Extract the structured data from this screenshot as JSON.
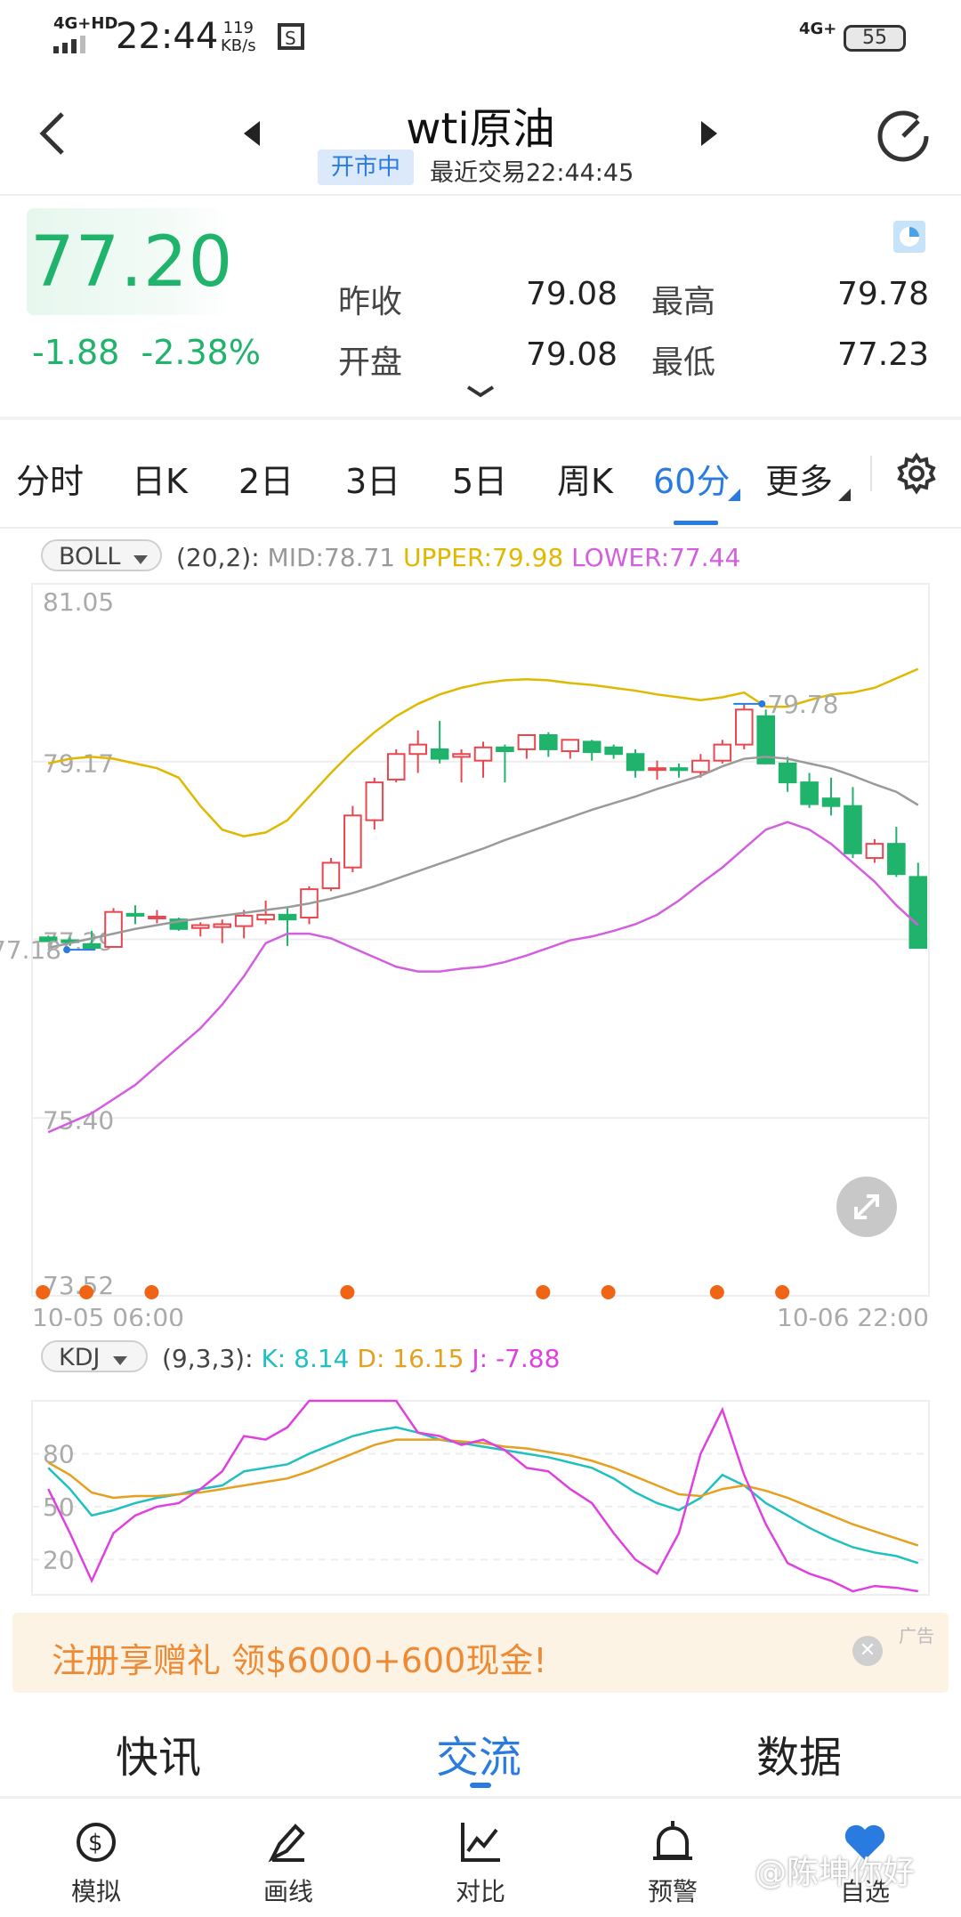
{
  "status_bar": {
    "network": "4G+HD",
    "time": "22:44",
    "speed_value": "119",
    "speed_unit": "KB/s",
    "network_right": "4G+",
    "battery": "55"
  },
  "header": {
    "title": "wti原油",
    "badge": "开市中",
    "last_trade": "最近交易22:44:45"
  },
  "quote": {
    "price": "77.20",
    "change": "-1.88",
    "change_pct": "-2.38%",
    "prev_close_label": "昨收",
    "prev_close": "79.08",
    "high_label": "最高",
    "high": "79.78",
    "open_label": "开盘",
    "open": "79.08",
    "low_label": "最低",
    "low": "77.23"
  },
  "tabs": {
    "t1": "分时",
    "t2": "日K",
    "t3": "2日",
    "t4": "3日",
    "t5": "5日",
    "t6": "周K",
    "t7": "60分",
    "t8": "更多"
  },
  "boll": {
    "name": "BOLL",
    "params": "(20,2):",
    "mid": "MID:78.71",
    "upper": "UPPER:79.98",
    "lower": "LOWER:77.44"
  },
  "kdj": {
    "name": "KDJ",
    "params": "(9,3,3):",
    "k": "K: 8.14",
    "d": "D: 16.15",
    "j": "J: -7.88"
  },
  "ad": {
    "text": "注册享赠礼 领$6000+600现金!",
    "tag": "广告"
  },
  "sections": {
    "s1": "快讯",
    "s2": "交流",
    "s3": "数据"
  },
  "bottom_nav": {
    "b1": "模拟",
    "b2": "画线",
    "b3": "对比",
    "b4": "预警",
    "b5": "自选"
  },
  "watermark": "@陈坤你好",
  "colors": {
    "up": "#e8474f",
    "down": "#1fb36b",
    "accent": "#2a7be0",
    "boll_upper": "#e0b800",
    "boll_mid": "#9a9a9a",
    "boll_lower": "#d45ee0",
    "kdj_k": "#20c0c0",
    "kdj_d": "#e6a020",
    "kdj_j": "#e040e0"
  },
  "chart_data": [
    {
      "type": "candlestick",
      "indicator": "BOLL(20,2)",
      "y_ticks": [
        "81.05",
        "79.17",
        "77.29",
        "75.40",
        "73.52"
      ],
      "ylim": [
        73.52,
        81.05
      ],
      "x_labels": [
        "10-05 06:00",
        "10-06 22:00"
      ],
      "annotations": {
        "max": "79.78",
        "min": "77.18"
      },
      "candles": [
        {
          "o": 77.31,
          "h": 77.33,
          "l": 77.27,
          "c": 77.27
        },
        {
          "o": 77.28,
          "h": 77.31,
          "l": 77.22,
          "c": 77.26
        },
        {
          "o": 77.24,
          "h": 77.38,
          "l": 77.18,
          "c": 77.2
        },
        {
          "o": 77.21,
          "h": 77.62,
          "l": 77.2,
          "c": 77.58
        },
        {
          "o": 77.56,
          "h": 77.65,
          "l": 77.45,
          "c": 77.54
        },
        {
          "o": 77.53,
          "h": 77.6,
          "l": 77.46,
          "c": 77.53
        },
        {
          "o": 77.5,
          "h": 77.52,
          "l": 77.38,
          "c": 77.4
        },
        {
          "o": 77.41,
          "h": 77.47,
          "l": 77.32,
          "c": 77.44
        },
        {
          "o": 77.42,
          "h": 77.5,
          "l": 77.25,
          "c": 77.45
        },
        {
          "o": 77.43,
          "h": 77.6,
          "l": 77.3,
          "c": 77.54
        },
        {
          "o": 77.5,
          "h": 77.7,
          "l": 77.45,
          "c": 77.55
        },
        {
          "o": 77.55,
          "h": 77.62,
          "l": 77.22,
          "c": 77.5
        },
        {
          "o": 77.52,
          "h": 77.85,
          "l": 77.45,
          "c": 77.82
        },
        {
          "o": 77.83,
          "h": 78.15,
          "l": 77.8,
          "c": 78.1
        },
        {
          "o": 78.05,
          "h": 78.7,
          "l": 78.0,
          "c": 78.6
        },
        {
          "o": 78.55,
          "h": 79.0,
          "l": 78.45,
          "c": 78.95
        },
        {
          "o": 78.98,
          "h": 79.3,
          "l": 78.95,
          "c": 79.25
        },
        {
          "o": 79.25,
          "h": 79.5,
          "l": 79.05,
          "c": 79.35
        },
        {
          "o": 79.3,
          "h": 79.6,
          "l": 79.15,
          "c": 79.2
        },
        {
          "o": 79.22,
          "h": 79.3,
          "l": 78.95,
          "c": 79.25
        },
        {
          "o": 79.18,
          "h": 79.38,
          "l": 79.0,
          "c": 79.32
        },
        {
          "o": 79.32,
          "h": 79.35,
          "l": 78.95,
          "c": 79.28
        },
        {
          "o": 79.3,
          "h": 79.45,
          "l": 79.2,
          "c": 79.45
        },
        {
          "o": 79.45,
          "h": 79.48,
          "l": 79.22,
          "c": 79.3
        },
        {
          "o": 79.28,
          "h": 79.4,
          "l": 79.2,
          "c": 79.4
        },
        {
          "o": 79.38,
          "h": 79.4,
          "l": 79.18,
          "c": 79.27
        },
        {
          "o": 79.32,
          "h": 79.35,
          "l": 79.2,
          "c": 79.25
        },
        {
          "o": 79.25,
          "h": 79.3,
          "l": 79.0,
          "c": 79.08
        },
        {
          "o": 79.1,
          "h": 79.18,
          "l": 78.98,
          "c": 79.1
        },
        {
          "o": 79.1,
          "h": 79.15,
          "l": 79.0,
          "c": 79.08
        },
        {
          "o": 79.06,
          "h": 79.25,
          "l": 79.0,
          "c": 79.18
        },
        {
          "o": 79.18,
          "h": 79.4,
          "l": 79.15,
          "c": 79.35
        },
        {
          "o": 79.35,
          "h": 79.78,
          "l": 79.3,
          "c": 79.72
        },
        {
          "o": 79.65,
          "h": 79.72,
          "l": 79.15,
          "c": 79.15
        },
        {
          "o": 79.15,
          "h": 79.22,
          "l": 78.85,
          "c": 78.95
        },
        {
          "o": 78.95,
          "h": 79.05,
          "l": 78.68,
          "c": 78.72
        },
        {
          "o": 78.78,
          "h": 79.0,
          "l": 78.6,
          "c": 78.7
        },
        {
          "o": 78.7,
          "h": 78.9,
          "l": 78.15,
          "c": 78.2
        },
        {
          "o": 78.15,
          "h": 78.35,
          "l": 78.1,
          "c": 78.3
        },
        {
          "o": 78.3,
          "h": 78.48,
          "l": 77.95,
          "c": 77.98
        },
        {
          "o": 77.95,
          "h": 78.1,
          "l": 77.35,
          "c": 77.2
        }
      ],
      "upper": [
        79.15,
        79.2,
        79.22,
        79.2,
        79.15,
        79.1,
        79.0,
        78.7,
        78.45,
        78.38,
        78.42,
        78.55,
        78.8,
        79.05,
        79.28,
        79.48,
        79.65,
        79.78,
        79.88,
        79.95,
        80.0,
        80.03,
        80.04,
        80.03,
        80.0,
        79.98,
        79.95,
        79.92,
        79.88,
        79.85,
        79.82,
        79.85,
        79.9,
        79.75,
        79.75,
        79.82,
        79.88,
        79.9,
        79.95,
        80.05,
        80.15
      ],
      "mid": [
        77.2,
        77.25,
        77.3,
        77.35,
        77.4,
        77.44,
        77.48,
        77.51,
        77.54,
        77.57,
        77.6,
        77.63,
        77.67,
        77.72,
        77.78,
        77.85,
        77.93,
        78.01,
        78.09,
        78.17,
        78.25,
        78.34,
        78.42,
        78.5,
        78.58,
        78.66,
        78.73,
        78.8,
        78.88,
        78.95,
        79.02,
        79.12,
        79.2,
        79.22,
        79.2,
        79.15,
        79.1,
        79.02,
        78.93,
        78.85,
        78.71
      ],
      "lower": [
        75.25,
        75.35,
        75.45,
        75.6,
        75.75,
        75.95,
        76.15,
        76.35,
        76.6,
        76.9,
        77.25,
        77.35,
        77.35,
        77.3,
        77.2,
        77.1,
        77.0,
        76.95,
        76.95,
        76.98,
        77.0,
        77.05,
        77.12,
        77.2,
        77.28,
        77.32,
        77.38,
        77.45,
        77.55,
        77.7,
        77.88,
        78.05,
        78.25,
        78.45,
        78.53,
        78.45,
        78.3,
        78.1,
        77.9,
        77.65,
        77.44
      ]
    },
    {
      "type": "line",
      "indicator": "KDJ(9,3,3)",
      "y_ticks": [
        "80",
        "50",
        "20"
      ],
      "ylim": [
        0,
        110
      ],
      "series": [
        {
          "name": "K",
          "values": [
            72,
            60,
            45,
            48,
            52,
            55,
            57,
            60,
            62,
            70,
            72,
            74,
            80,
            85,
            90,
            93,
            95,
            92,
            88,
            86,
            84,
            82,
            80,
            78,
            75,
            72,
            66,
            58,
            52,
            48,
            55,
            68,
            62,
            52,
            45,
            38,
            32,
            27,
            24,
            22,
            18
          ]
        },
        {
          "name": "D",
          "values": [
            75,
            68,
            58,
            55,
            56,
            56,
            57,
            58,
            60,
            62,
            64,
            66,
            70,
            75,
            80,
            85,
            88,
            88,
            88,
            87,
            86,
            84,
            83,
            81,
            79,
            76,
            72,
            67,
            62,
            57,
            56,
            60,
            62,
            59,
            55,
            50,
            45,
            40,
            36,
            32,
            28
          ]
        },
        {
          "name": "J",
          "values": [
            60,
            35,
            8,
            35,
            45,
            50,
            52,
            60,
            70,
            90,
            88,
            95,
            115,
            120,
            122,
            120,
            112,
            92,
            90,
            85,
            88,
            82,
            72,
            70,
            60,
            52,
            35,
            20,
            12,
            35,
            80,
            105,
            68,
            40,
            18,
            12,
            8,
            2,
            5,
            4,
            2
          ]
        }
      ]
    }
  ]
}
